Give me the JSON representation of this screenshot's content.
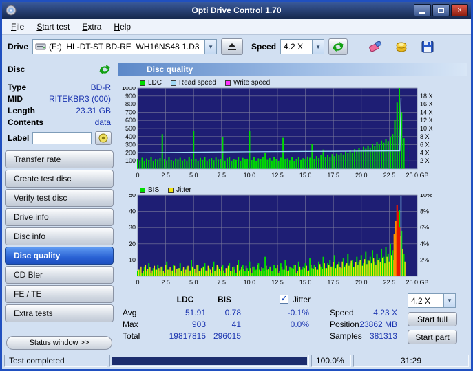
{
  "window": {
    "title": "Opti Drive Control 1.70"
  },
  "menu": {
    "items": [
      "File",
      "Start test",
      "Extra",
      "Help"
    ]
  },
  "toolbar": {
    "drive_label": "Drive",
    "drive_value": "(F:)  HL-DT-ST BD-RE  WH16NS48 1.D3",
    "speed_label": "Speed",
    "speed_value": "4.2 X"
  },
  "sidebar": {
    "section_title": "Disc",
    "info": [
      {
        "label": "Type",
        "value": "BD-R"
      },
      {
        "label": "MID",
        "value": "RITEKBR3 (000)"
      },
      {
        "label": "Length",
        "value": "23.31 GB"
      },
      {
        "label": "Contents",
        "value": "data"
      }
    ],
    "label_caption": "Label",
    "label_value": "",
    "buttons": [
      {
        "label": "Transfer rate"
      },
      {
        "label": "Create test disc"
      },
      {
        "label": "Verify test disc"
      },
      {
        "label": "Drive info"
      },
      {
        "label": "Disc info"
      },
      {
        "label": "Disc quality",
        "selected": true
      },
      {
        "label": "CD Bler"
      },
      {
        "label": "FE / TE"
      },
      {
        "label": "Extra tests"
      }
    ],
    "status_button": "Status window >>"
  },
  "main": {
    "header": "Disc quality"
  },
  "stats": {
    "headers": {
      "ldc": "LDC",
      "bis": "BIS",
      "jitter": "Jitter"
    },
    "jitter_check": "✓",
    "rows": [
      {
        "label": "Avg",
        "ldc": "51.91",
        "bis": "0.78",
        "jitter": "-0.1%"
      },
      {
        "label": "Max",
        "ldc": "903",
        "bis": "41",
        "jitter": "0.0%"
      },
      {
        "label": "Total",
        "ldc": "19817815",
        "bis": "296015",
        "jitter": ""
      }
    ],
    "speed_label": "Speed",
    "speed_value": "4.23 X",
    "speed_select": "4.2 X",
    "position_label": "Position",
    "position_value": "23862 MB",
    "samples_label": "Samples",
    "samples_value": "381313",
    "start_full": "Start full",
    "start_part": "Start part"
  },
  "statusbar": {
    "status": "Test completed",
    "percent": "100.0%",
    "time": "31:29",
    "progress_percent": 100
  },
  "chart_data": [
    {
      "type": "line",
      "name": "disc-quality-main-chart",
      "title": "Disc quality",
      "x_range": [
        0,
        25
      ],
      "x_ticks": [
        0,
        2.5,
        5,
        7.5,
        10,
        12.5,
        15,
        17.5,
        20,
        22.5,
        25
      ],
      "x_unit": "GB",
      "left_axis": {
        "range": [
          0,
          1000
        ],
        "ticks": [
          100,
          200,
          300,
          400,
          500,
          600,
          700,
          800,
          900,
          1000
        ]
      },
      "right_axis": {
        "range": [
          0,
          20
        ],
        "ticks": [
          2,
          4,
          6,
          8,
          10,
          12,
          14,
          16,
          18
        ],
        "suffix": " X"
      },
      "bg": "#1e1e74",
      "grid": "#7c7c9c",
      "border": "#aabbd4",
      "series": [
        {
          "name": "LDC",
          "color": "#00dc00",
          "style": "bars",
          "axis": "left",
          "x0": 0,
          "dx": 0.2,
          "width": 2,
          "y": [
            120,
            105,
            140,
            95,
            130,
            110,
            150,
            100,
            125,
            115,
            135,
            430,
            120,
            105,
            145,
            110,
            95,
            130,
            115,
            140,
            105,
            125,
            96,
            150,
            118,
            470,
            128,
            102,
            138,
            112,
            148,
            98,
            122,
            135,
            108,
            142,
            116,
            126,
            390,
            104,
            134,
            146,
            100,
            124,
            112,
            152,
            96,
            138,
            118,
            128,
            470,
            110,
            144,
            98,
            132,
            120,
            150,
            200,
            114,
            136,
            104,
            148,
            122,
            94,
            140,
            385,
            118,
            132,
            108,
            152,
            100,
            126,
            146,
            112,
            134,
            122,
            155,
            140,
            310,
            128,
            160,
            135,
            170,
            240,
            150,
            175,
            145,
            185,
            160,
            190,
            170,
            200,
            180,
            215,
            195,
            230,
            205,
            245,
            220,
            260,
            235,
            275,
            250,
            290,
            265,
            310,
            285,
            330,
            305,
            350,
            325,
            370,
            345,
            400,
            430,
            600,
            820,
            1000,
            700,
            380
          ]
        },
        {
          "name": "Read speed",
          "color": "#9fd8f4",
          "style": "line",
          "axis": "right",
          "width": 1.3,
          "x": [
            0,
            2.5,
            5,
            7.5,
            10,
            12.5,
            15,
            17.5,
            20,
            22,
            23,
            23.45,
            23.55
          ],
          "y": [
            4.02,
            4.08,
            4.15,
            4.2,
            4.26,
            4.3,
            4.34,
            4.38,
            4.42,
            4.45,
            4.47,
            4.48,
            17.6
          ]
        },
        {
          "name": "Write speed",
          "color": "#ff30ff",
          "style": "line",
          "axis": "right",
          "width": 1.3,
          "x": [],
          "y": []
        }
      ]
    },
    {
      "type": "line",
      "name": "bis-jitter-chart",
      "title": "BIS / Jitter",
      "x_range": [
        0,
        25
      ],
      "x_ticks": [
        0,
        2.5,
        5,
        7.5,
        10,
        12.5,
        15,
        17.5,
        20,
        22.5,
        25
      ],
      "x_unit": "GB",
      "left_axis": {
        "range": [
          0,
          50
        ],
        "ticks": [
          10,
          20,
          30,
          40,
          50
        ]
      },
      "right_axis": {
        "range": [
          0,
          10
        ],
        "ticks": [
          2,
          4,
          6,
          8,
          10
        ],
        "suffix": "%"
      },
      "bg": "#1e1e74",
      "grid": "#7c7c9c",
      "border": "#aabbd4",
      "series": [
        {
          "name": "BIS",
          "color": "#00dc00",
          "style": "bars",
          "axis": "left",
          "x0": 0,
          "dx": 0.2,
          "width": 2,
          "y": [
            3,
            4,
            2,
            6,
            3,
            8,
            2,
            5,
            4,
            7,
            3,
            6,
            2,
            9,
            4,
            3,
            7,
            2,
            5,
            8,
            4,
            2,
            6,
            3,
            10,
            5,
            2,
            7,
            3,
            6,
            8,
            3,
            5,
            2,
            9,
            4,
            6,
            3,
            7,
            2,
            5,
            8,
            3,
            6,
            2,
            10,
            4,
            7,
            3,
            5,
            9,
            2,
            6,
            4,
            8,
            3,
            5,
            12,
            4,
            6,
            3,
            7,
            5,
            2,
            8,
            4,
            10,
            3,
            6,
            5,
            7,
            2,
            9,
            4,
            6,
            8,
            3,
            11,
            5,
            7,
            4,
            9,
            6,
            12,
            5,
            8,
            10,
            6,
            13,
            7,
            9,
            5,
            11,
            7,
            14,
            8,
            10,
            6,
            12,
            9,
            13,
            8,
            15,
            10,
            12,
            16,
            9,
            14,
            11,
            17,
            12,
            18,
            14,
            20,
            16,
            25,
            35,
            41,
            28,
            14
          ]
        },
        {
          "name": "Jitter",
          "color": "#f2e410",
          "style": "bars",
          "axis": "right",
          "x0": 0.1,
          "dx": 0.2,
          "width": 1.4,
          "y": [
            0.8,
            1.2,
            0.6,
            1.4,
            0.9,
            1.1,
            0.7,
            1.3,
            0.8,
            1.0,
            1.2,
            0.6,
            1.4,
            0.8,
            1.1,
            0.7,
            1.3,
            0.9,
            1.0,
            0.6,
            1.1,
            0.8,
            1.3,
            0.7,
            1.2,
            0.9,
            1.4,
            0.6,
            1.0,
            1.2,
            0.7,
            1.3,
            0.8,
            1.1,
            0.6,
            1.4,
            0.9,
            1.2,
            0.7,
            1.0,
            1.3,
            0.6,
            1.1,
            0.8,
            1.4,
            0.7,
            1.2,
            0.9,
            1.3,
            0.6,
            1.0,
            1.2,
            0.7,
            1.4,
            0.8,
            1.1,
            0.6,
            1.3,
            0.9,
            1.2,
            0.7,
            1.0,
            1.4,
            0.6,
            1.2,
            0.8,
            1.3,
            0.7,
            1.1,
            0.9,
            1.4,
            0.6,
            1.2,
            0.8,
            1.0,
            1.3,
            0.7,
            1.4,
            0.9,
            1.1,
            0.8,
            1.5,
            0.9,
            1.6,
            1.0,
            1.4,
            1.2,
            1.7,
            1.0,
            1.5,
            1.1,
            1.8,
            1.2,
            1.6,
            1.3,
            1.9,
            1.1,
            1.7,
            1.4,
            2.0,
            1.3,
            2.1,
            1.5,
            1.9,
            1.6,
            2.2,
            1.4,
            2.0,
            1.7,
            2.3,
            1.6,
            2.4,
            1.8,
            2.6,
            2.0,
            3.0,
            4.2,
            5.0,
            3.4,
            1.8
          ]
        },
        {
          "name": "high-bis-spike-orange",
          "legend": false,
          "color": "#ff9000",
          "style": "bars",
          "axis": "left",
          "width": 2.2,
          "x": [
            22.95,
            23.1
          ],
          "y": [
            26,
            34
          ]
        },
        {
          "name": "high-bis-spike-red",
          "legend": false,
          "color": "#e81800",
          "style": "bars",
          "axis": "left",
          "width": 2.2,
          "x": [
            23.2,
            23.3,
            23.42
          ],
          "y": [
            44,
            40,
            30
          ]
        },
        {
          "name": "end-marker",
          "legend": false,
          "color": "#8fd8f8",
          "style": "bars",
          "axis": "left",
          "width": 1.5,
          "x": [
            23.55
          ],
          "y": [
            49.5
          ]
        }
      ]
    }
  ]
}
